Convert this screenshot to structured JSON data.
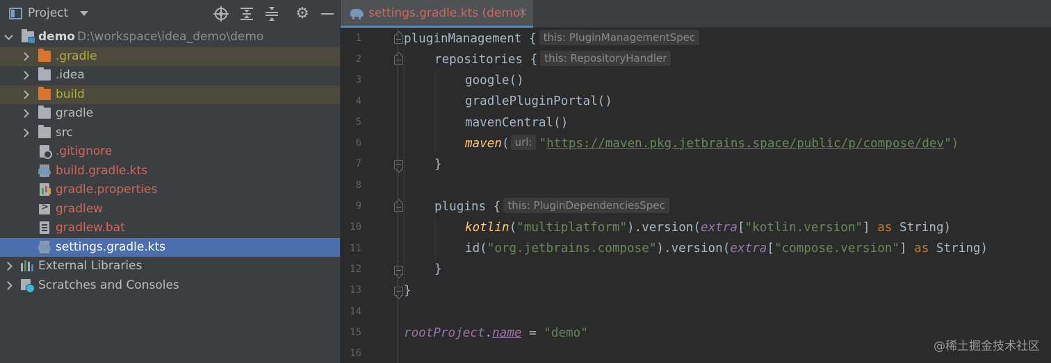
{
  "project_panel": {
    "title": "Project",
    "icons": [
      "project-view-icon",
      "dropdown-caret-icon",
      "locate-icon",
      "expand-all-icon",
      "collapse-all-icon",
      "gear-icon",
      "hide-icon"
    ],
    "tree": [
      {
        "label": "demo",
        "path": "D:\\workspace\\idea_demo\\demo",
        "kind": "module",
        "expanded": true
      },
      {
        "label": ".gradle",
        "kind": "folder-orange",
        "status": "ignored"
      },
      {
        "label": ".idea",
        "kind": "folder",
        "status": "plain"
      },
      {
        "label": "build",
        "kind": "folder-orange",
        "status": "ignored"
      },
      {
        "label": "gradle",
        "kind": "folder",
        "status": "plain"
      },
      {
        "label": "src",
        "kind": "folder",
        "status": "plain"
      },
      {
        "label": ".gitignore",
        "kind": "file-ignore",
        "status": "untracked"
      },
      {
        "label": "build.gradle.kts",
        "kind": "file-gradle",
        "status": "untracked"
      },
      {
        "label": "gradle.properties",
        "kind": "file-properties",
        "status": "untracked"
      },
      {
        "label": "gradlew",
        "kind": "file-terminal",
        "status": "untracked"
      },
      {
        "label": "gradlew.bat",
        "kind": "file-bat",
        "status": "untracked"
      },
      {
        "label": "settings.gradle.kts",
        "kind": "file-gradle",
        "status": "selected"
      },
      {
        "label": "External Libraries",
        "kind": "libraries"
      },
      {
        "label": "Scratches and Consoles",
        "kind": "scratches"
      }
    ]
  },
  "editor": {
    "tab": {
      "title": "settings.gradle.kts (demo)",
      "close": "×"
    },
    "line_numbers": [
      "1",
      "2",
      "3",
      "4",
      "5",
      "6",
      "7",
      "8",
      "9",
      "10",
      "11",
      "12",
      "13",
      "14",
      "15",
      "16"
    ],
    "lines": {
      "l1": {
        "code": "pluginManagement {",
        "hint": "this: PluginManagementSpec"
      },
      "l2": {
        "code": "repositories {",
        "hint": "this: RepositoryHandler"
      },
      "l3": {
        "code": "google()"
      },
      "l4": {
        "code": "gradlePluginPortal()"
      },
      "l5": {
        "code": "mavenCentral()"
      },
      "l6": {
        "fn": "maven",
        "open": "(",
        "hint": "url:",
        "q1": "\"",
        "url": "https://maven.pkg.jetbrains.space/public/p/compose/dev",
        "close": "\")"
      },
      "l7": {
        "code": "}"
      },
      "l9": {
        "code": "plugins {",
        "hint": "this: PluginDependenciesSpec"
      },
      "l10": {
        "fn": "kotlin",
        "open": "(",
        "str1": "\"multiplatform\"",
        "mid": ").version(",
        "extra": "extra",
        "lb": "[",
        "str2": "\"kotlin.version\"",
        "rb": "] ",
        "kw": "as",
        "type": " String)"
      },
      "l11": {
        "fn": "id(",
        "str1": "\"org.jetbrains.compose\"",
        "mid": ").version(",
        "extra": "extra",
        "lb": "[",
        "str2": "\"compose.version\"",
        "rb": "] ",
        "kw": "as",
        "type": " String)"
      },
      "l12": {
        "code": "}"
      },
      "l13": {
        "code": "}"
      },
      "l15": {
        "obj": "rootProject",
        "dot": ".",
        "prop": "name",
        "eq": " = ",
        "str": "\"demo\""
      }
    }
  },
  "watermark": "@稀土掘金技术社区",
  "colors": {
    "panel_bg": "#3c3f41",
    "editor_bg": "#2b2b2b",
    "selection": "#4b6eaf",
    "untracked": "#d1675a",
    "ignored": "#b4ae3c",
    "keyword": "#cc7832",
    "string": "#6a8759",
    "function": "#ffc66d",
    "property": "#9876aa"
  }
}
